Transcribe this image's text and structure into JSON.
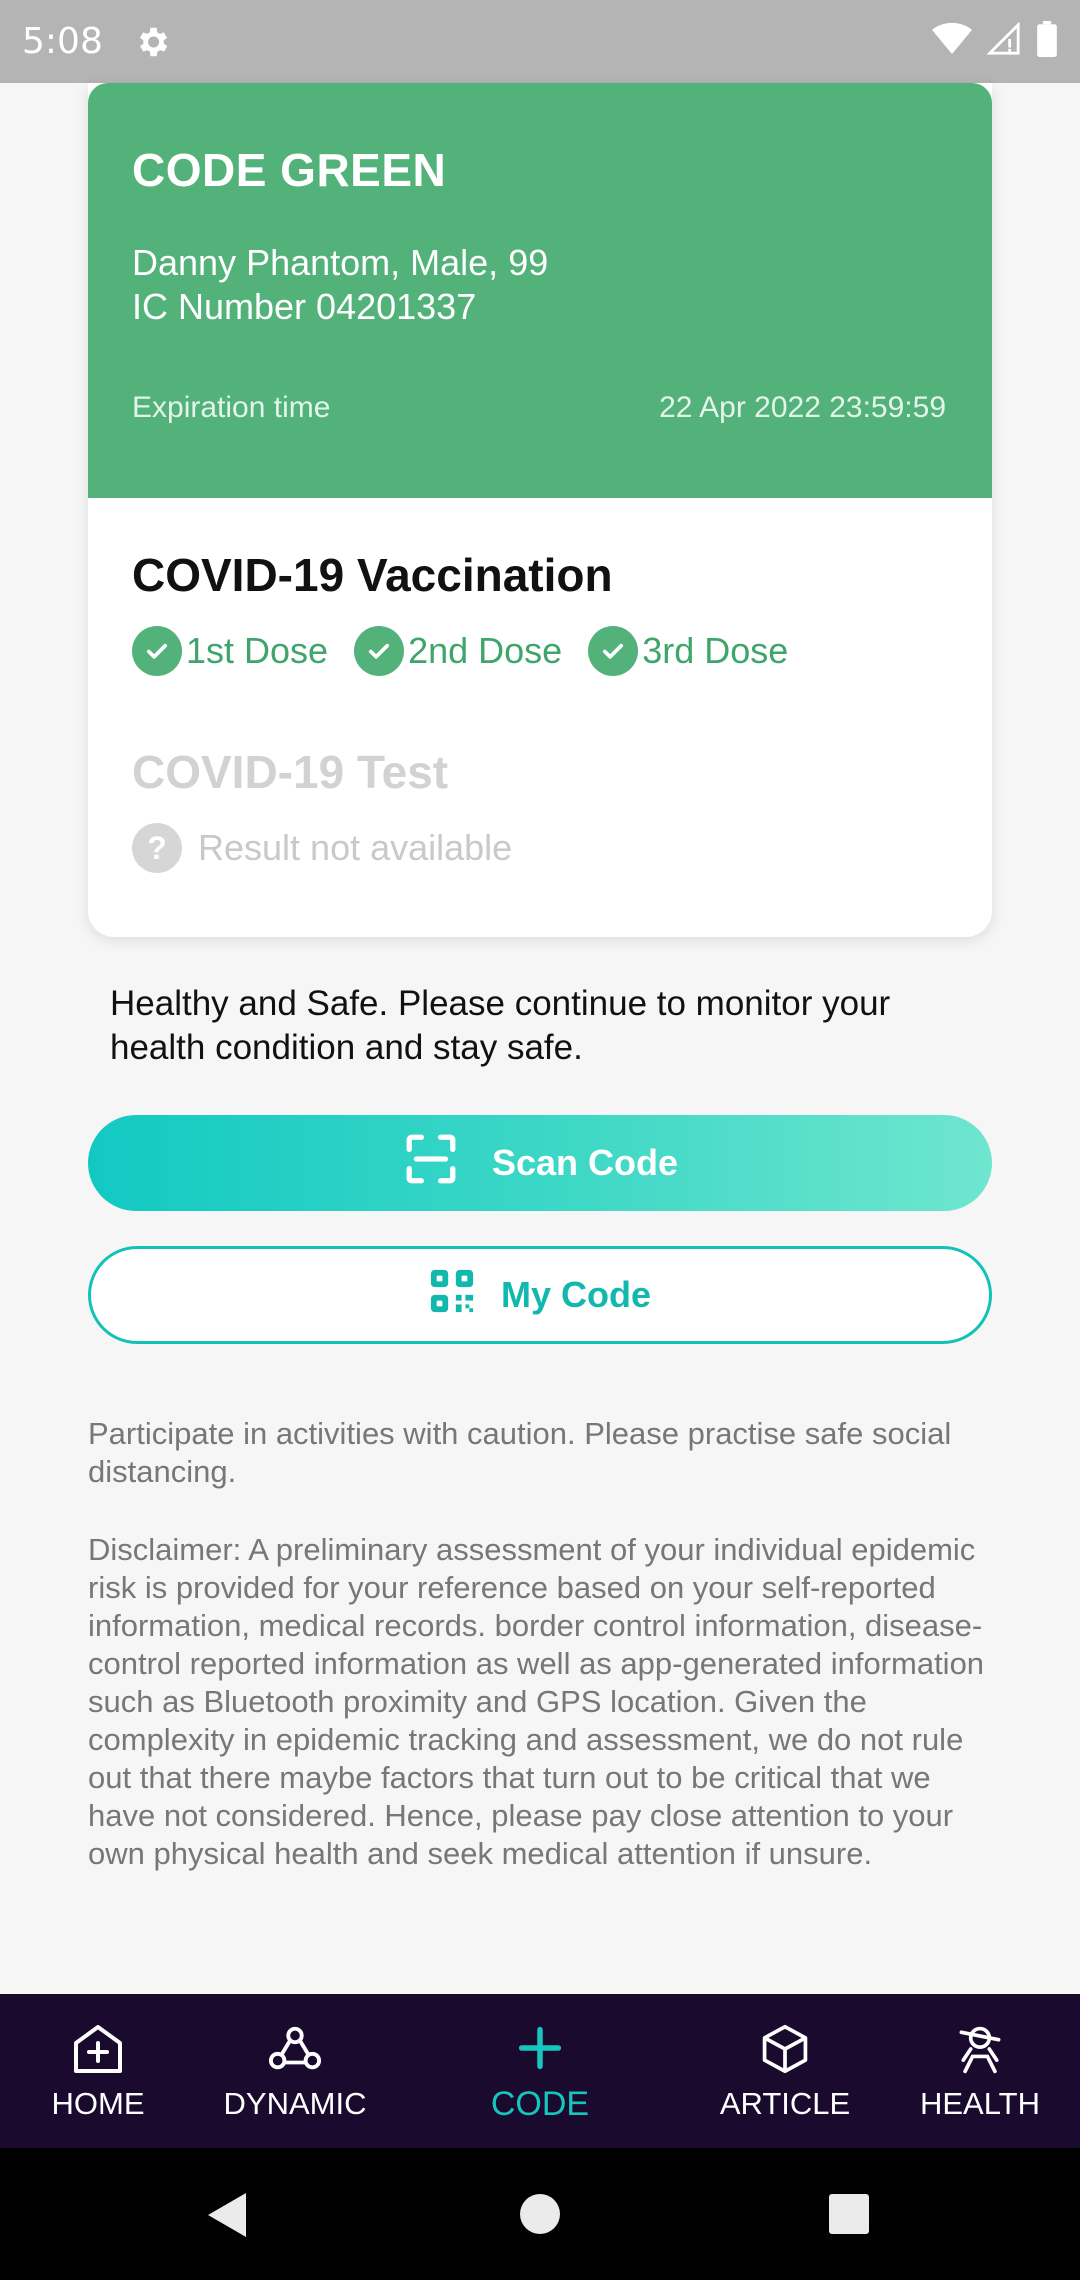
{
  "status_bar": {
    "time": "5:08",
    "icons": [
      "gear-icon",
      "wifi-icon",
      "signal-icon",
      "battery-icon"
    ]
  },
  "card": {
    "code_title": "CODE GREEN",
    "person_line1": "Danny Phantom, Male, 99",
    "person_line2": "IC Number 04201337",
    "expiration_label": "Expiration time",
    "expiration_value": "22 Apr 2022 23:59:59",
    "vaccination_title": "COVID-19 Vaccination",
    "doses": [
      {
        "label": "1st Dose"
      },
      {
        "label": "2nd Dose"
      },
      {
        "label": "3rd Dose"
      }
    ],
    "test_title": "COVID-19 Test",
    "test_result": "Result not available"
  },
  "message": "Healthy and Safe. Please continue to monitor your health condition and stay safe.",
  "buttons": {
    "scan_code": "Scan Code",
    "my_code": "My Code"
  },
  "caution": "Participate in activities with caution. Please practise safe social distancing.",
  "disclaimer": "Disclaimer: A preliminary assessment of your individual epidemic risk is provided for your reference based on your self-reported information, medical records. border control information, disease-control reported information as well as app-generated information such as Bluetooth proximity and GPS location. Given the complexity in epidemic tracking and assessment, we do not rule out that there maybe factors that turn out to be critical that we have not considered. Hence, please pay close attention to your own physical health and seek medical attention if unsure.",
  "bottom_nav": {
    "items": [
      {
        "label": "HOME",
        "icon": "home-plus-icon"
      },
      {
        "label": "DYNAMIC",
        "icon": "network-icon"
      },
      {
        "label": "CODE",
        "icon": "plus-icon",
        "active": true
      },
      {
        "label": "ARTICLE",
        "icon": "box-icon"
      },
      {
        "label": "HEALTH",
        "icon": "person-health-icon"
      }
    ]
  },
  "colors": {
    "code_green": "#52b27a",
    "accent_teal": "#12c2b6",
    "nav_background": "#1a0a2e"
  }
}
